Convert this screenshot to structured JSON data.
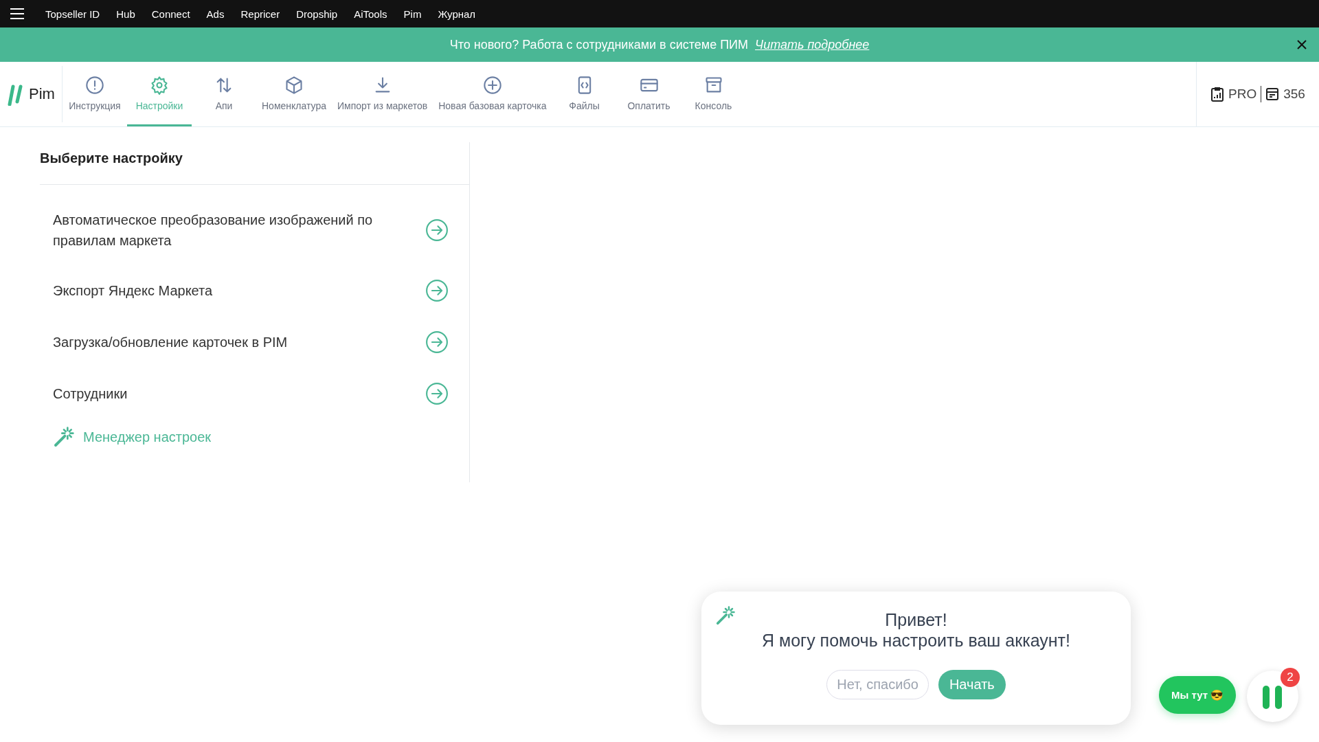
{
  "top_menu": {
    "items": [
      "Topseller ID",
      "Hub",
      "Connect",
      "Ads",
      "Repricer",
      "Dropship",
      "AiTools",
      "Pim",
      "Журнал"
    ]
  },
  "banner": {
    "text": "Что нового?  Работа с сотрудниками в системе ПИМ",
    "link": "Читать подробнее"
  },
  "app": {
    "logo": "Pim"
  },
  "tabs": [
    {
      "label": "Инструкция",
      "selected": false
    },
    {
      "label": "Настройки",
      "selected": true
    },
    {
      "label": "Апи",
      "selected": false
    },
    {
      "label": "Номенклатура",
      "selected": false
    },
    {
      "label": "Импорт из маркетов",
      "selected": false
    },
    {
      "label": "Новая базовая карточка",
      "selected": false
    },
    {
      "label": "Файлы",
      "selected": false
    },
    {
      "label": "Оплатить",
      "selected": false
    },
    {
      "label": "Консоль",
      "selected": false
    }
  ],
  "account": {
    "plan": "PRO",
    "count": "356"
  },
  "settings": {
    "title": "Выберите настройку",
    "items": [
      "Автоматическое преобразование изображений по правилам маркета",
      "Экспорт Яндекс Маркета",
      "Загрузка/обновление карточек в PIM",
      "Сотрудники"
    ],
    "manager": "Менеджер настроек"
  },
  "assistant": {
    "greeting": "Привет!",
    "message": "Я могу помочь настроить ваш аккаунт!",
    "decline": "Нет, спасибо",
    "start": "Начать"
  },
  "chat": {
    "label": "Мы тут 😎",
    "badge": "2"
  }
}
